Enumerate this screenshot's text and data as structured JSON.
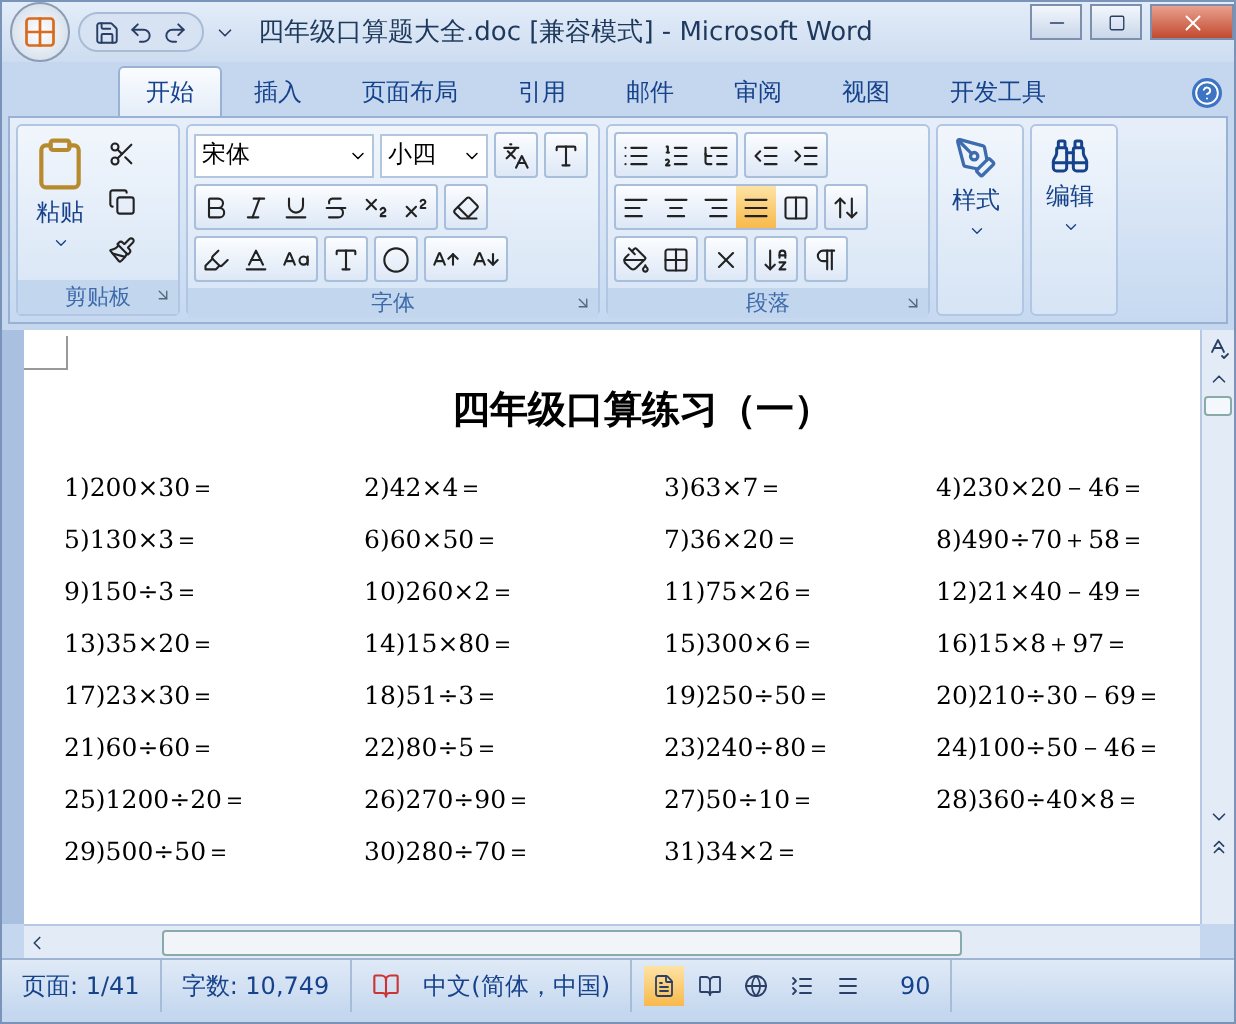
{
  "window": {
    "title": "四年级口算题大全.doc [兼容模式] - Microsoft Word"
  },
  "tabs": [
    {
      "label": "开始",
      "selected": true
    },
    {
      "label": "插入",
      "selected": false
    },
    {
      "label": "页面布局",
      "selected": false
    },
    {
      "label": "引用",
      "selected": false
    },
    {
      "label": "邮件",
      "selected": false
    },
    {
      "label": "审阅",
      "selected": false
    },
    {
      "label": "视图",
      "selected": false
    },
    {
      "label": "开发工具",
      "selected": false
    }
  ],
  "ribbon": {
    "clipboard": {
      "paste_label": "粘贴",
      "group_label": "剪贴板"
    },
    "font": {
      "font_name": "宋体",
      "font_size": "小四",
      "group_label": "字体"
    },
    "paragraph": {
      "alignments": [
        {
          "kind": "left",
          "selected": false
        },
        {
          "kind": "center",
          "selected": false
        },
        {
          "kind": "right",
          "selected": false
        },
        {
          "kind": "justify",
          "selected": true
        },
        {
          "kind": "distributed",
          "selected": false
        }
      ],
      "group_label": "段落"
    },
    "styles": {
      "label": "样式"
    },
    "editing": {
      "label": "编辑"
    }
  },
  "document": {
    "heading": "四年级口算练习（一）",
    "problems": [
      "1)200×30＝",
      "2)42×4＝",
      "3)63×7＝",
      "4)230×20－46＝",
      "5)130×3＝",
      "6)60×50＝",
      "7)36×20＝",
      "8)490÷70＋58＝",
      "9)150÷3＝",
      "10)260×2＝",
      "11)75×26＝",
      "12)21×40－49＝",
      "13)35×20＝",
      "14)15×80＝",
      "15)300×6＝",
      "16)15×8＋97＝",
      "17)23×30＝",
      "18)51÷3＝",
      "19)250÷50＝",
      "20)210÷30－69＝",
      "21)60÷60＝",
      "22)80÷5＝",
      "23)240÷80＝",
      "24)100÷50－46＝",
      "25)1200÷20＝",
      "26)270÷90＝",
      "27)50÷10＝",
      "28)360÷40×8＝",
      "29)500÷50＝",
      "30)280÷70＝",
      "31)34×2＝"
    ]
  },
  "status_bar": {
    "page": "页面: 1/41",
    "words": "字数: 10,749",
    "language": "中文(简体，中国)",
    "views": [
      {
        "kind": "print",
        "selected": true
      },
      {
        "kind": "reading",
        "selected": false
      },
      {
        "kind": "web",
        "selected": false
      },
      {
        "kind": "outline",
        "selected": false
      },
      {
        "kind": "draft",
        "selected": false
      }
    ],
    "zoom": "90"
  }
}
